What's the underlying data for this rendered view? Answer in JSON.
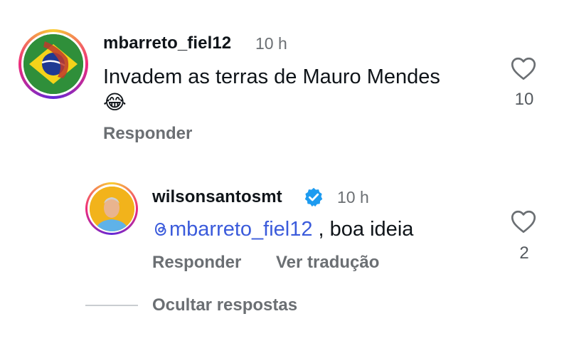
{
  "comments": [
    {
      "username": "mbarreto_fiel12",
      "time": "10 h",
      "text": "Invadem as terras de Mauro Mendes",
      "emoji": "😂",
      "like_count": "10",
      "reply_label": "Responder"
    }
  ],
  "reply": {
    "username": "wilsonsantosmt",
    "time": "10 h",
    "mention": "mbarreto_fiel12",
    "text": " , boa ideia",
    "like_count": "2",
    "reply_label": "Responder",
    "translate_label": "Ver tradução"
  },
  "hide_replies_label": "Ocultar respostas",
  "colors": {
    "mention": "#3b5bdb",
    "verified": "#1d9bf0",
    "muted": "#6b6f73"
  }
}
